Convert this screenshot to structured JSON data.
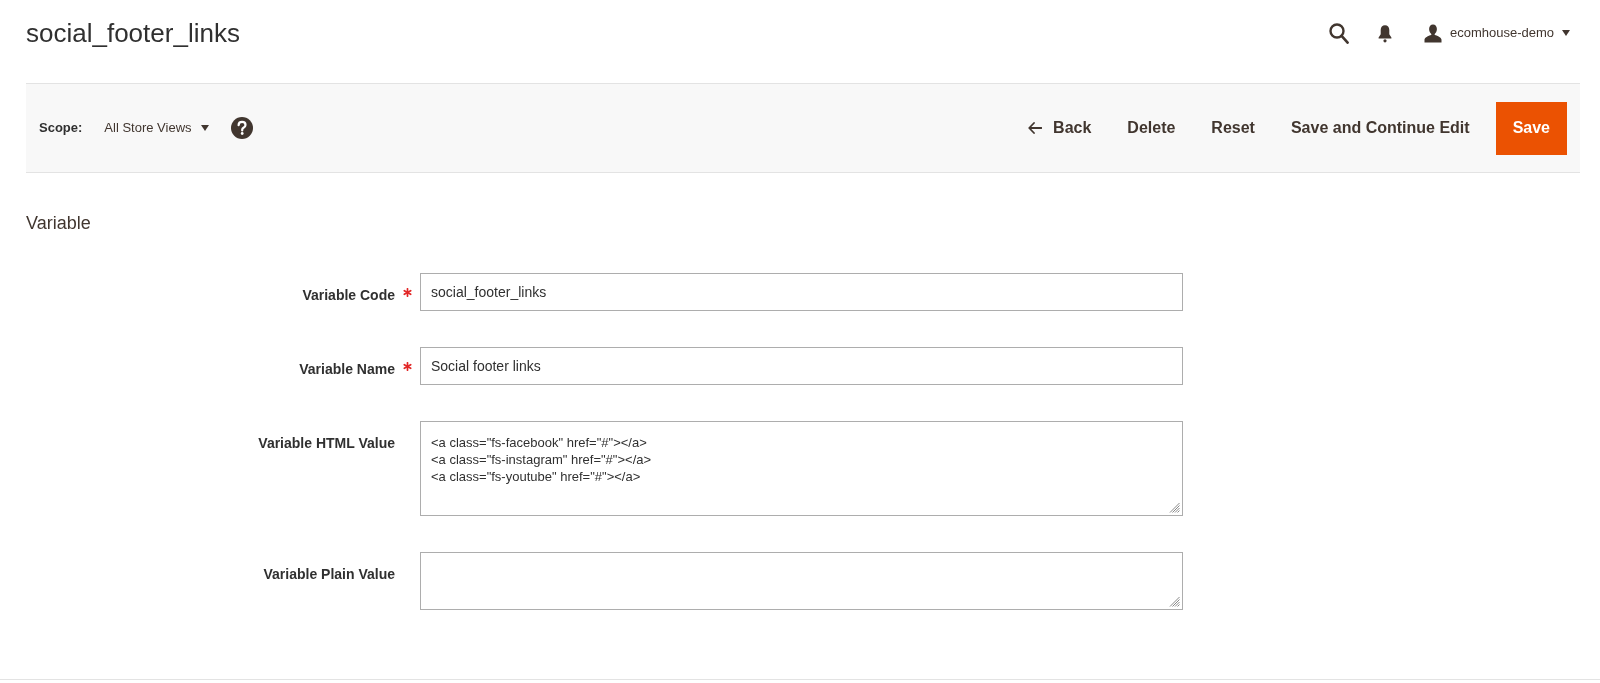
{
  "header": {
    "title": "social_footer_links",
    "user_name": "ecomhouse-demo"
  },
  "toolbar": {
    "scope": {
      "label": "Scope:",
      "value": "All Store Views"
    },
    "actions": [
      {
        "label": "Back",
        "kind": "back"
      },
      {
        "label": "Delete",
        "kind": "plain"
      },
      {
        "label": "Reset",
        "kind": "plain"
      },
      {
        "label": "Save and Continue Edit",
        "kind": "plain"
      },
      {
        "label": "Save",
        "kind": "primary"
      }
    ]
  },
  "section": {
    "title": "Variable",
    "fields": [
      {
        "label": "Variable Code",
        "required": true,
        "kind": "input",
        "value": "social_footer_links"
      },
      {
        "label": "Variable Name",
        "required": true,
        "kind": "input",
        "value": "Social footer links"
      },
      {
        "label": "Variable HTML Value",
        "required": false,
        "kind": "textarea",
        "value": "<a class=\"fs-facebook\" href=\"#\"></a>\n<a class=\"fs-instagram\" href=\"#\"></a>\n<a class=\"fs-youtube\" href=\"#\"></a>"
      },
      {
        "label": "Variable Plain Value",
        "required": false,
        "kind": "textarea"
      }
    ]
  }
}
